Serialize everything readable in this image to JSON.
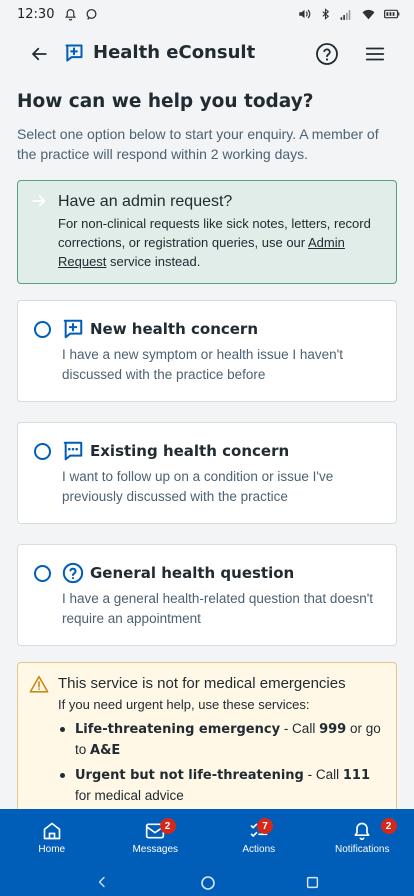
{
  "status_bar": {
    "time": "12:30"
  },
  "app_bar": {
    "title": "Health eConsult"
  },
  "page": {
    "heading": "How can we help you today?",
    "intro": "Select one option below to start your enquiry. A member of the practice will respond within 2 working days."
  },
  "admin": {
    "title": "Have an admin request?",
    "body_start": "For non-clinical requests like sick notes, letters, record corrections, or registration queries, use our ",
    "link": "Admin Request",
    "body_end": " service instead."
  },
  "options": [
    {
      "title": "New health concern",
      "desc": "I have a new symptom or health issue I haven't discussed with the practice before"
    },
    {
      "title": "Existing health concern",
      "desc": "I want to follow up on a condition or issue I've previously discussed with the practice"
    },
    {
      "title": "General health question",
      "desc": "I have a general health-related question that doesn't require an appointment"
    }
  ],
  "warning": {
    "title": "This service is not for medical emergencies",
    "sub": "If you need urgent help, use these services:",
    "items": [
      {
        "strong": "Life-threatening emergency",
        "mid": " - Call ",
        "num": "999",
        "tail": " or go to ",
        "tail_strong": "A&E"
      },
      {
        "strong": "Urgent but not life-threatening",
        "mid": " - Call ",
        "num": "111",
        "tail": " for medical advice",
        "tail_strong": ""
      }
    ]
  },
  "bottom_nav": [
    {
      "label": "Home",
      "badge": ""
    },
    {
      "label": "Messages",
      "badge": "2"
    },
    {
      "label": "Actions",
      "badge": "7"
    },
    {
      "label": "Notifications",
      "badge": "2"
    }
  ],
  "colors": {
    "primary": "#005eb8",
    "admin_bg": "#e1ede8",
    "admin_border": "#5a9e84",
    "warning_bg": "#fff8e6",
    "warning_border": "#e6c48b",
    "badge": "#d5281b"
  }
}
